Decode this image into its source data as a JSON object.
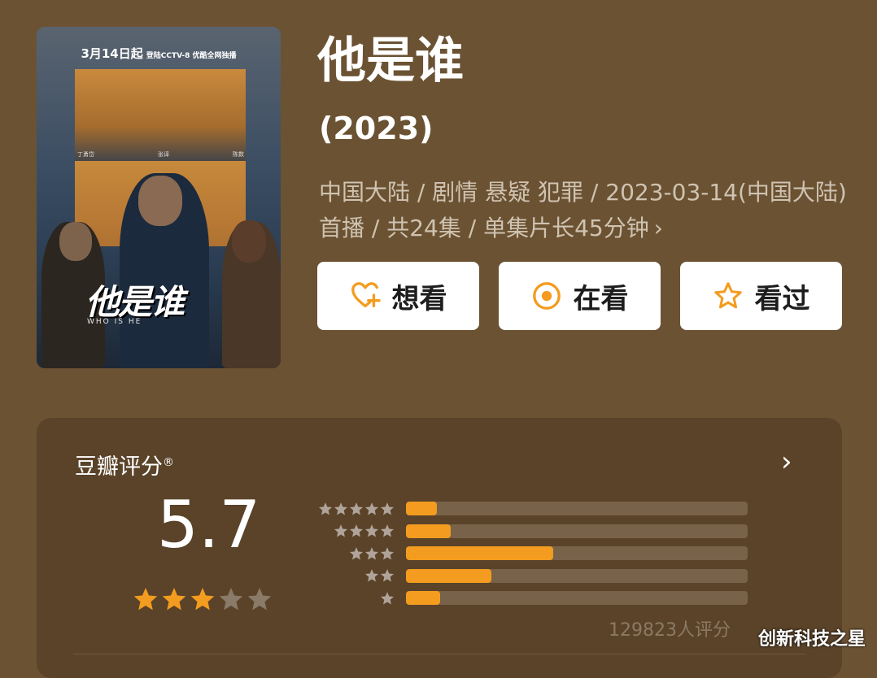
{
  "poster": {
    "badge_date": "3月14日起",
    "badge_sub": "登陆CCTV-8 优酷全网独播",
    "title": "他是谁",
    "subtitle": "WHO IS HE",
    "cast": [
      "丁勇岱",
      "张译",
      "陈数"
    ]
  },
  "show": {
    "title": "他是谁",
    "year": "(2023)",
    "meta": "中国大陆 / 剧情 悬疑 犯罪 / 2023-03-14(中国大陆)首播 / 共24集 / 单集片长45分钟"
  },
  "actions": [
    {
      "label": "想看",
      "icon": "heart-plus-icon"
    },
    {
      "label": "在看",
      "icon": "target-icon"
    },
    {
      "label": "看过",
      "icon": "star-icon"
    }
  ],
  "rating": {
    "label": "豆瓣评分",
    "mark": "®",
    "score": "5.7",
    "stars_filled": 3,
    "stars_total": 5,
    "count": "129823人评分",
    "distribution": [
      {
        "stars": 5,
        "fraction": 0.09
      },
      {
        "stars": 4,
        "fraction": 0.13
      },
      {
        "stars": 3,
        "fraction": 0.43
      },
      {
        "stars": 2,
        "fraction": 0.25
      },
      {
        "stars": 1,
        "fraction": 0.1
      }
    ]
  },
  "colors": {
    "background": "#6b5233",
    "card": "#5a4329",
    "accent": "#f39c1f",
    "star_empty": "#8a7a68",
    "dist_star": "#b0a49a"
  },
  "watermark": "创新科技之星"
}
